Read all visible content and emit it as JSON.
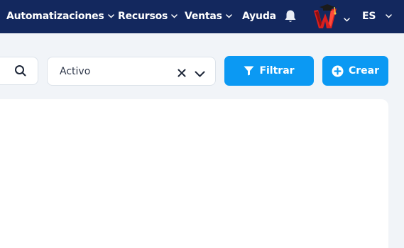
{
  "nav": {
    "items": [
      {
        "label": "Automatizaciones",
        "has_dropdown": true
      },
      {
        "label": "Recursos",
        "has_dropdown": true
      },
      {
        "label": "Ventas",
        "has_dropdown": true
      },
      {
        "label": "Ayuda",
        "has_dropdown": false
      }
    ],
    "notifications_icon": "bell-icon",
    "avatar_icon": "user-avatar",
    "language": "ES"
  },
  "toolbar": {
    "search_icon": "search-icon",
    "status_filter": {
      "value": "Activo",
      "clear_icon": "x-icon",
      "caret_icon": "chevron-down-icon"
    },
    "filter_button": {
      "label": "Filtrar",
      "icon": "funnel-icon"
    },
    "create_button": {
      "label": "Crear",
      "icon": "plus-circle-icon"
    }
  },
  "colors": {
    "nav_bg": "#13285e",
    "accent": "#0b99f3",
    "page_bg": "#f1f4f8"
  }
}
